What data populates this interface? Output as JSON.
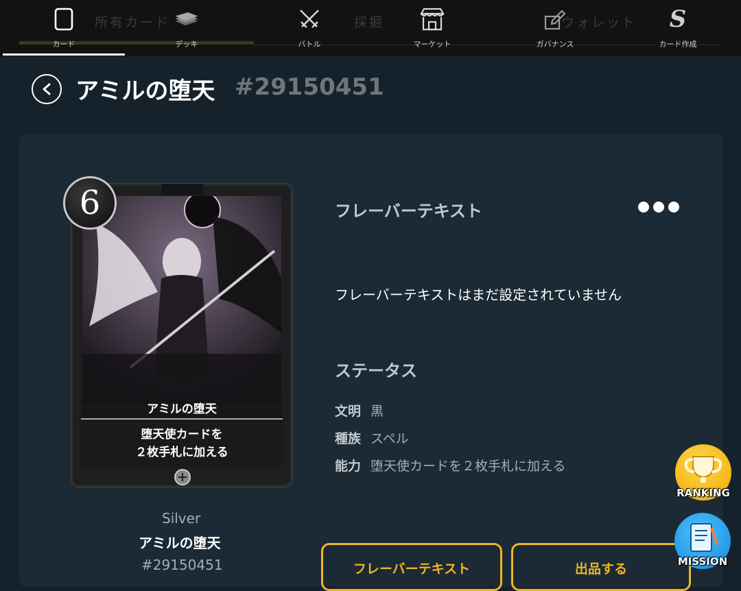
{
  "nav": {
    "ghost_left": "所有カード",
    "ghost_mid": "採掘",
    "ghost_right": "ウォレット",
    "items": [
      {
        "label": "カード",
        "icon": "card-icon"
      },
      {
        "label": "デッキ",
        "icon": "deck-icon"
      },
      {
        "label": "バトル",
        "icon": "crossed-swords-icon"
      },
      {
        "label": "マーケット",
        "icon": "shop-icon"
      },
      {
        "label": "ガバナンス",
        "icon": "governance-icon"
      },
      {
        "label": "カード作成",
        "icon": "s-logo-icon"
      }
    ],
    "s_glyph": "S"
  },
  "header": {
    "title": "アミルの堕天",
    "id": "#29150451"
  },
  "card": {
    "cost": "6",
    "name": "アミルの堕天",
    "text_line1": "堕天使カードを",
    "text_line2": "２枚手札に加える",
    "rarity": "Silver",
    "caption_name": "アミルの堕天",
    "caption_id": "#29150451"
  },
  "flavor": {
    "heading": "フレーバーテキスト",
    "empty_message": "フレーバーテキストはまだ設定されていません"
  },
  "status": {
    "heading": "ステータス",
    "rows": [
      {
        "label": "文明",
        "value": "黒"
      },
      {
        "label": "種族",
        "value": "スペル"
      },
      {
        "label": "能力",
        "value": "堕天使カードを２枚手札に加える"
      }
    ]
  },
  "buttons": {
    "flavor_text": "フレーバーテキスト",
    "list_for_sale": "出品する"
  },
  "badges": {
    "ranking": "RANKING",
    "mission": "MISSION"
  },
  "colors": {
    "accent": "#f2b522",
    "background": "#16222b",
    "panel": "#1b2a34",
    "nav": "#121212"
  }
}
